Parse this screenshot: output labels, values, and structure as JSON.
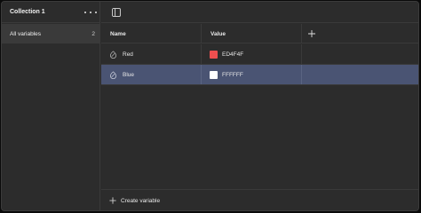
{
  "sidebar": {
    "title": "Collection 1",
    "more_icon": "more-horizontal-icon",
    "items": [
      {
        "label": "All variables",
        "count": "2"
      }
    ]
  },
  "toolbar": {
    "toggle_icon": "sidebar-toggle-icon"
  },
  "table": {
    "columns": [
      "Name",
      "Value"
    ],
    "add_column_icon": "plus-icon",
    "rows": [
      {
        "name": "Red",
        "value": "ED4F4F",
        "color": "#ED4F4F",
        "selected": false
      },
      {
        "name": "Blue",
        "value": "FFFFFF",
        "color": "#FFFFFF",
        "selected": true
      }
    ]
  },
  "footer": {
    "create_label": "Create variable",
    "create_icon": "plus-icon"
  },
  "colors": {
    "background": "#2c2c2c",
    "selected_row": "#4a5473",
    "sidebar_selected": "#3a3a3a"
  }
}
